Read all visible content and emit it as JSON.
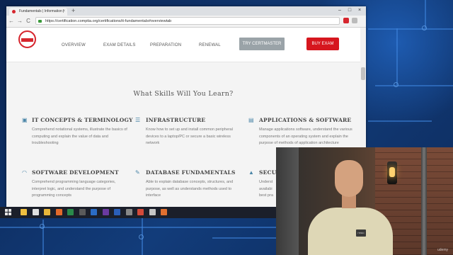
{
  "browser": {
    "tab_title": "Fundamentals | Information |",
    "tab_close": "×",
    "new_tab": "+",
    "window_controls": [
      "–",
      "□",
      "×"
    ],
    "url": "https://certification.comptia.org/certifications/it-fundamentals#overviewtab",
    "nav": {
      "back": "←",
      "forward": "→",
      "reload": "C"
    }
  },
  "site": {
    "nav_links": [
      "OVERVIEW",
      "EXAM DETAILS",
      "PREPARATION",
      "RENEWAL"
    ],
    "try_button": "TRY CERTMASTER",
    "buy_button": "BUY EXAM",
    "accent_color": "#d6161e",
    "icon_color": "#4b86a8"
  },
  "skills": {
    "title": "What Skills Will You Learn?",
    "items": [
      {
        "icon": "chip-icon",
        "glyph": "▣",
        "title": "IT CONCEPTS & TERMINOLOGY",
        "desc": "Comprehend notational systems, illustrate the basics of computing and explain the value of data and troubleshooting"
      },
      {
        "icon": "server-icon",
        "glyph": "☰",
        "title": "INFRASTRUCTURE",
        "desc": "Know how to set up and install common peripheral devices to a laptop/PC or secure a basic wireless network"
      },
      {
        "icon": "document-icon",
        "glyph": "▤",
        "title": "APPLICATIONS & SOFTWARE",
        "desc": "Manage applications software, understand the various components of an operating system and explain the purpose of methods of application architecture"
      },
      {
        "icon": "wifi-icon",
        "glyph": "◠",
        "title": "SOFTWARE DEVELOPMENT",
        "desc": "Comprehend programming language categories, interpret logic, and understand the purpose of programming concepts"
      },
      {
        "icon": "wrench-icon",
        "glyph": "✎",
        "title": "DATABASE FUNDAMENTALS",
        "desc": "Able to explain database concepts, structures, and purpose, as well as understands methods used to interface"
      },
      {
        "icon": "lock-icon",
        "glyph": "▲",
        "title": "SECURITY",
        "desc": "Underst availabi best pra"
      }
    ]
  },
  "taskbar": {
    "icons": [
      {
        "name": "explorer-icon",
        "color": "#f0c040"
      },
      {
        "name": "chrome-icon",
        "color": "#e0e0e0"
      },
      {
        "name": "folder-icon",
        "color": "#e8b63a"
      },
      {
        "name": "media-icon",
        "color": "#e36a2b"
      },
      {
        "name": "excel-icon",
        "color": "#2a8a4a"
      },
      {
        "name": "terminal-icon",
        "color": "#5a5a5a"
      },
      {
        "name": "app-icon",
        "color": "#2b6cc4"
      },
      {
        "name": "visio-icon",
        "color": "#6a3aa0"
      },
      {
        "name": "word-icon",
        "color": "#2b5fb8"
      },
      {
        "name": "settings-icon",
        "color": "#888888"
      },
      {
        "name": "chrome-active-icon",
        "color": "#d34a3a"
      },
      {
        "name": "notes-icon",
        "color": "#c6c6c6"
      },
      {
        "name": "powerpoint-icon",
        "color": "#e07030"
      }
    ]
  },
  "webcam": {
    "shirt_logo": "ITPRO",
    "watermark": "udemy"
  }
}
